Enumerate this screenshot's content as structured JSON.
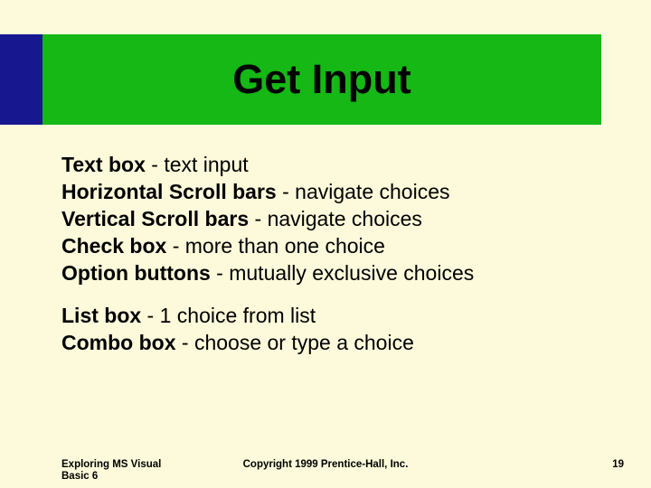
{
  "title": "Get Input",
  "items": [
    {
      "term": "Text box",
      "desc": " - text input"
    },
    {
      "term": "Horizontal Scroll bars",
      "desc": " - navigate choices"
    },
    {
      "term": "Vertical Scroll bars",
      "desc": " - navigate choices"
    },
    {
      "term": "Check box",
      "desc": " - more than one choice"
    },
    {
      "term": "Option buttons",
      "desc": " - mutually exclusive choices"
    }
  ],
  "items2": [
    {
      "term": "List box",
      "desc": " - 1 choice from list"
    },
    {
      "term": "Combo box",
      "desc": " - choose or type a choice"
    }
  ],
  "footer": {
    "left": "Exploring MS Visual Basic 6",
    "center": "Copyright 1999 Prentice-Hall, Inc.",
    "page": "19"
  }
}
